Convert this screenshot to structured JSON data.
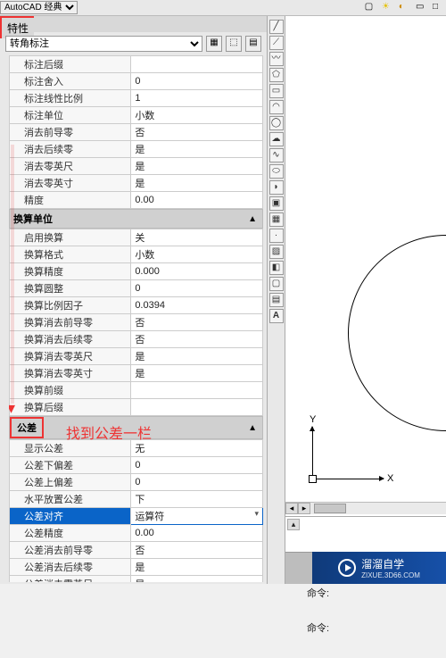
{
  "menubar": {
    "workspace": "AutoCAD 经典"
  },
  "panel": {
    "title": "特性",
    "object_selector": "转角标注"
  },
  "icons": {
    "quick_select": "▦",
    "pick": "⬚",
    "toggle": "▤"
  },
  "sections": {
    "primary": {
      "rows": [
        {
          "label": "标注后缀",
          "value": ""
        },
        {
          "label": "标注舍入",
          "value": "0"
        },
        {
          "label": "标注线性比例",
          "value": "1"
        },
        {
          "label": "标注单位",
          "value": "小数"
        },
        {
          "label": "消去前导零",
          "value": "否"
        },
        {
          "label": "消去后续零",
          "value": "是"
        },
        {
          "label": "消去零英尺",
          "value": "是"
        },
        {
          "label": "消去零英寸",
          "value": "是"
        },
        {
          "label": "精度",
          "value": "0.00"
        }
      ]
    },
    "alt_units": {
      "header": "换算单位",
      "rows": [
        {
          "label": "启用换算",
          "value": "关"
        },
        {
          "label": "换算格式",
          "value": "小数"
        },
        {
          "label": "换算精度",
          "value": "0.000"
        },
        {
          "label": "换算圆整",
          "value": "0"
        },
        {
          "label": "换算比例因子",
          "value": "0.0394"
        },
        {
          "label": "换算消去前导零",
          "value": "否"
        },
        {
          "label": "换算消去后续零",
          "value": "否"
        },
        {
          "label": "换算消去零英尺",
          "value": "是"
        },
        {
          "label": "换算消去零英寸",
          "value": "是"
        },
        {
          "label": "换算前缀",
          "value": ""
        },
        {
          "label": "换算后缀",
          "value": ""
        }
      ]
    },
    "tolerance": {
      "header": "公差",
      "rows": [
        {
          "label": "显示公差",
          "value": "无"
        },
        {
          "label": "公差下偏差",
          "value": "0"
        },
        {
          "label": "公差上偏差",
          "value": "0"
        },
        {
          "label": "水平放置公差",
          "value": "下"
        },
        {
          "label": "公差对齐",
          "value": "运算符",
          "selected": true
        },
        {
          "label": "公差精度",
          "value": "0.00"
        },
        {
          "label": "公差消去前导零",
          "value": "否"
        },
        {
          "label": "公差消去后续零",
          "value": "是"
        },
        {
          "label": "公差消去零英尺",
          "value": "是"
        }
      ]
    }
  },
  "annotation": "找到公差一栏",
  "ucs": {
    "x": "X",
    "y": "Y"
  },
  "cmd": {
    "l1": "命令:",
    "l2": "命令:",
    "prompt": "命令:"
  },
  "watermark": {
    "brand": "溜溜自学",
    "url": "ZIXUE.3D66.COM"
  }
}
